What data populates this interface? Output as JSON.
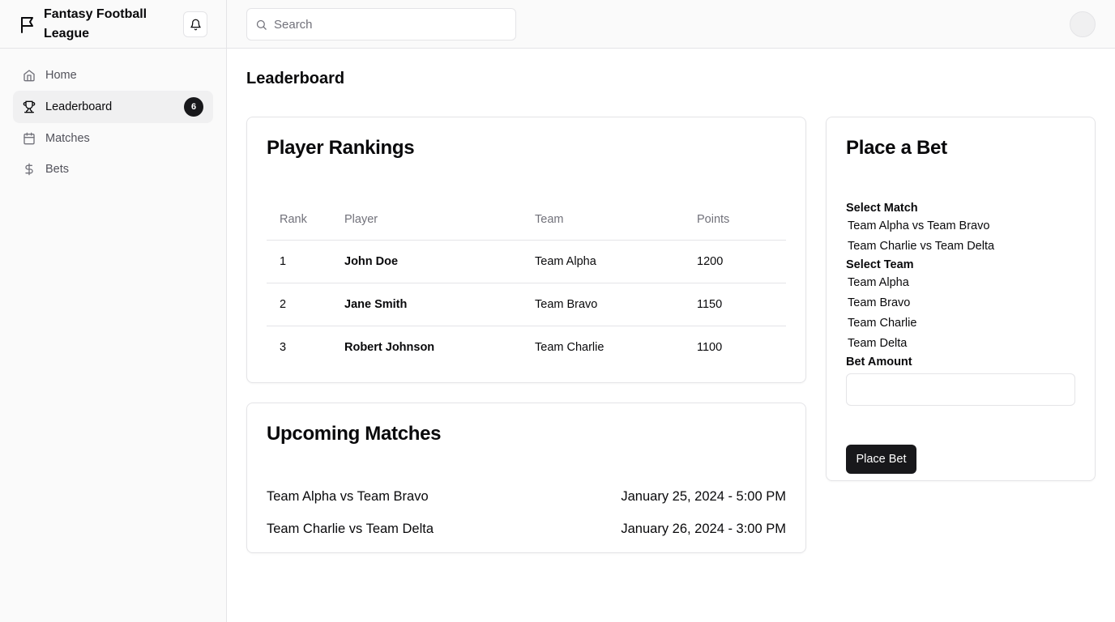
{
  "app": {
    "title": "Fantasy Football League",
    "bell_icon": "bell-icon",
    "brand_icon": "flag-icon"
  },
  "sidebar": {
    "items": [
      {
        "label": "Home",
        "icon": "home-icon",
        "active": false
      },
      {
        "label": "Leaderboard",
        "icon": "trophy-icon",
        "active": true,
        "badge": "6"
      },
      {
        "label": "Matches",
        "icon": "calendar-icon",
        "active": false
      },
      {
        "label": "Bets",
        "icon": "dollar-icon",
        "active": false
      }
    ]
  },
  "search": {
    "placeholder": "Search",
    "value": ""
  },
  "page": {
    "title": "Leaderboard"
  },
  "rankings": {
    "title": "Player Rankings",
    "columns": [
      "Rank",
      "Player",
      "Team",
      "Points"
    ],
    "rows": [
      {
        "rank": "1",
        "player": "John Doe",
        "team": "Team Alpha",
        "points": "1200"
      },
      {
        "rank": "2",
        "player": "Jane Smith",
        "team": "Team Bravo",
        "points": "1150"
      },
      {
        "rank": "3",
        "player": "Robert Johnson",
        "team": "Team Charlie",
        "points": "1100"
      }
    ]
  },
  "matches": {
    "title": "Upcoming Matches",
    "items": [
      {
        "name": "Team Alpha vs Team Bravo",
        "date": "January 25, 2024 - 5:00 PM"
      },
      {
        "name": "Team Charlie vs Team Delta",
        "date": "January 26, 2024 - 3:00 PM"
      }
    ]
  },
  "bet": {
    "title": "Place a Bet",
    "match_label": "Select Match",
    "match_options": [
      "Team Alpha vs Team Bravo",
      "Team Charlie vs Team Delta"
    ],
    "team_label": "Select Team",
    "team_options": [
      "Team Alpha",
      "Team Bravo",
      "Team Charlie",
      "Team Delta"
    ],
    "amount_label": "Bet Amount",
    "amount_value": "",
    "submit_label": "Place Bet"
  },
  "colors": {
    "accent": "#18181b",
    "border": "#e4e4e7",
    "muted_text": "#71717a",
    "sidebar_bg": "#fafafa"
  }
}
